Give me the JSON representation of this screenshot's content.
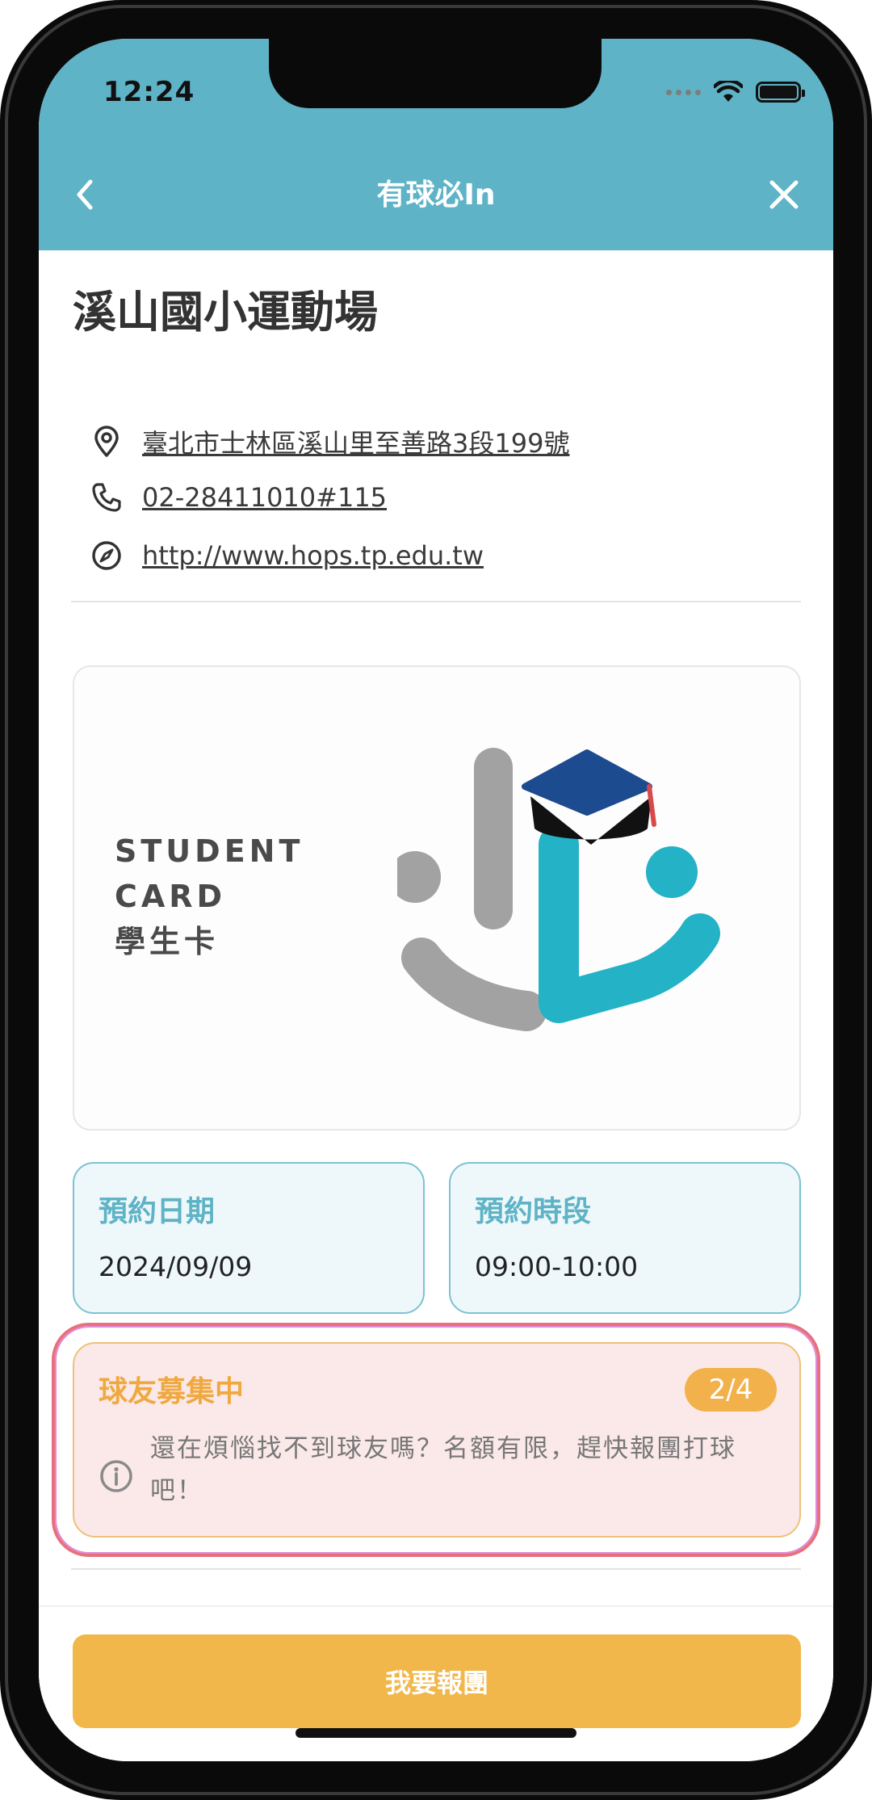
{
  "status_bar": {
    "time": "12:24"
  },
  "nav": {
    "title": "有球必In"
  },
  "venue": {
    "name": "溪山國小運動場",
    "address": "臺北市士林區溪山里至善路3段199號",
    "phone": "02-28411010#115",
    "website": "http://www.hops.tp.edu.tw"
  },
  "card": {
    "line1": "STUDENT",
    "line2": "CARD",
    "line3": "學生卡"
  },
  "booking": {
    "date_label": "預約日期",
    "date_value": "2024/09/09",
    "time_label": "預約時段",
    "time_value": "09:00-10:00"
  },
  "recruit": {
    "title": "球友募集中",
    "count": "2/4",
    "message": "還在煩惱找不到球友嗎？名額有限，趕快報團打球吧！"
  },
  "action": {
    "join_label": "我要報團"
  },
  "colors": {
    "header": "#5fb3c6",
    "accent": "#f2b74a",
    "recruit_bg": "#fae9e8"
  }
}
